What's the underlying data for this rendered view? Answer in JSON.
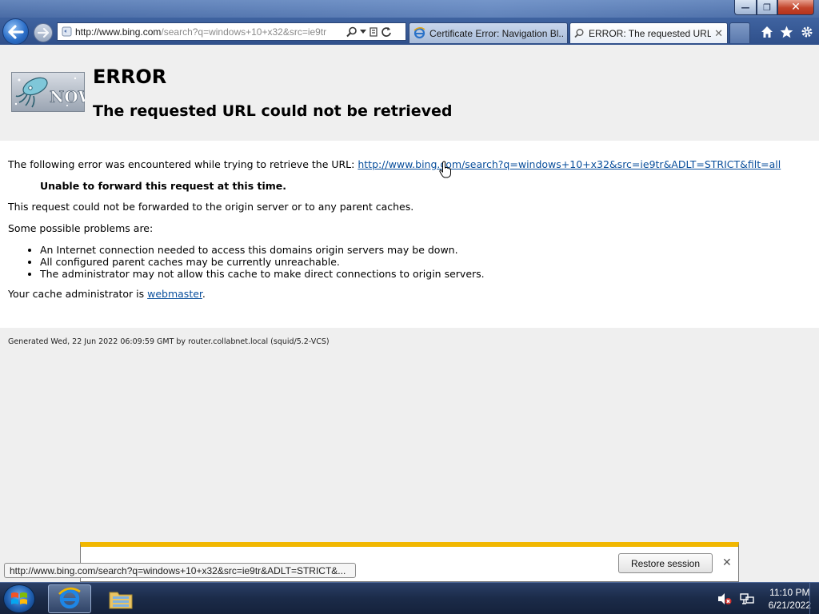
{
  "browser": {
    "address_url_host": "http://www.bing.com",
    "address_url_rest": "/search?q=windows+10+x32&src=ie9tr",
    "tabs": [
      {
        "label": "Certificate Error: Navigation Bl...",
        "active": false
      },
      {
        "label": "ERROR: The requested URL ...",
        "active": true
      }
    ],
    "window_buttons": {
      "minimize": "—",
      "maximize": "❐",
      "close": "✕"
    },
    "tab_close_glyph": "✕"
  },
  "page": {
    "title": "ERROR",
    "subtitle": "The requested URL could not be retrieved",
    "intro_text": "The following error was encountered while trying to retrieve the URL: ",
    "intro_url": "http://www.bing.com/search?q=windows+10+x32&src=ie9tr&ADLT=STRICT&filt=all",
    "error_heading": "Unable to forward this request at this time.",
    "description": "This request could not be forwarded to the origin server or to any parent caches.",
    "problems_intro": "Some possible problems are:",
    "problems": [
      "An Internet connection needed to access this domains origin servers may be down.",
      "All configured parent caches may be currently unreachable.",
      "The administrator may not allow this cache to make direct connections to origin servers."
    ],
    "admin_prefix": "Your cache administrator is ",
    "admin_link": "webmaster",
    "admin_suffix": ".",
    "footer": "Generated Wed, 22 Jun 2022 06:09:59 GMT by router.collabnet.local (squid/5.2-VCS)",
    "logo_text": "NOW"
  },
  "notification": {
    "restore_label": "Restore session",
    "close_glyph": "✕"
  },
  "status_bar": {
    "hover_url": "http://www.bing.com/search?q=windows+10+x32&src=ie9tr&ADLT=STRICT&..."
  },
  "taskbar": {
    "time": "11:10 PM",
    "date": "6/21/2022"
  },
  "colors": {
    "link": "#0a4f9c",
    "notification_accent": "#f1b700",
    "chrome_blue": "#3f63a0"
  },
  "icons": [
    "back-arrow-icon",
    "forward-arrow-icon",
    "page-icon",
    "search-icon",
    "compat-view-icon",
    "refresh-icon",
    "ie-tab-icon",
    "home-icon",
    "favorites-star-icon",
    "tools-gear-icon",
    "squid-logo",
    "hand-cursor-icon",
    "windows-start-icon",
    "ie-taskbar-icon",
    "folder-taskbar-icon",
    "volume-muted-icon",
    "network-icon"
  ]
}
